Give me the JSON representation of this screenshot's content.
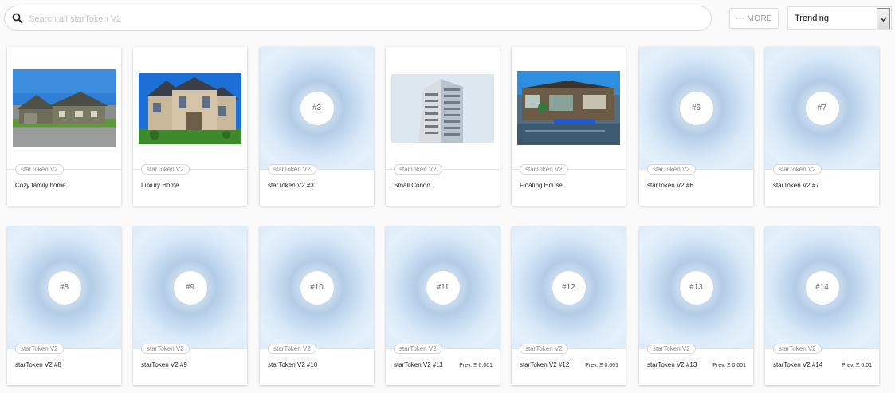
{
  "search": {
    "placeholder": "Search all starToken V2"
  },
  "toolbar": {
    "more_label": "··· MORE",
    "sort_value": "Trending"
  },
  "cards": [
    {
      "chip": "starToken V2",
      "title": "Cozy family home",
      "image": "house-photo"
    },
    {
      "chip": "starToken V2",
      "title": "Luxury Home",
      "image": "mansion-photo"
    },
    {
      "chip": "starToken V2",
      "title": "starToken V2 #3",
      "badge": "#3"
    },
    {
      "chip": "starToken V2",
      "title": "Small Condo",
      "image": "condo-photo"
    },
    {
      "chip": "starToken V2",
      "title": "Floating House",
      "image": "houseboat-photo"
    },
    {
      "chip": "starToken V2",
      "title": "starToken V2 #6",
      "badge": "#6"
    },
    {
      "chip": "starToken V2",
      "title": "starToken V2 #7",
      "badge": "#7"
    },
    {
      "chip": "starToken V2",
      "title": "starToken V2 #8",
      "badge": "#8"
    },
    {
      "chip": "starToken V2",
      "title": "starToken V2 #9",
      "badge": "#9"
    },
    {
      "chip": "starToken V2",
      "title": "starToken V2 #10",
      "badge": "#10"
    },
    {
      "chip": "starToken V2",
      "title": "starToken V2 #11",
      "badge": "#11",
      "price": "Prev. Ξ 0,001"
    },
    {
      "chip": "starToken V2",
      "title": "starToken V2 #12",
      "badge": "#12",
      "price": "Prev. Ξ 0,001"
    },
    {
      "chip": "starToken V2",
      "title": "starToken V2 #13",
      "badge": "#13",
      "price": "Prev. Ξ 0,001"
    },
    {
      "chip": "starToken V2",
      "title": "starToken V2 #14",
      "badge": "#14",
      "price": "Prev. Ξ 0,01"
    }
  ]
}
